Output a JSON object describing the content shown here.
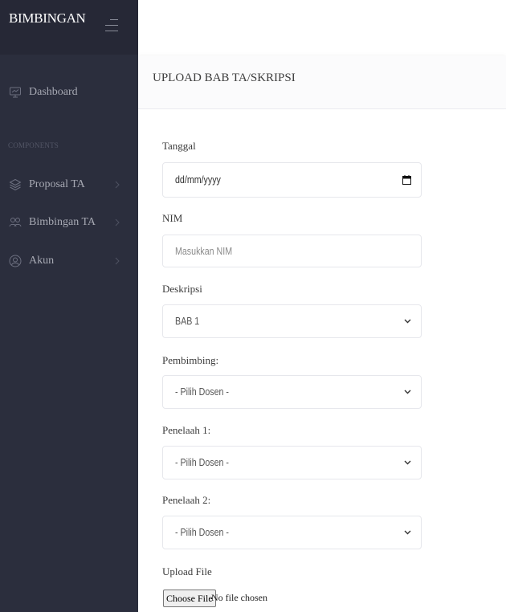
{
  "sidebar": {
    "brand": "BIMBINGAN",
    "section_label": "COMPONENTS",
    "items": [
      {
        "label": "Dashboard",
        "icon": "monitor-icon"
      },
      {
        "label": "Proposal TA",
        "icon": "layers-icon"
      },
      {
        "label": "Bimbingan TA",
        "icon": "users-icon"
      },
      {
        "label": "Akun",
        "icon": "user-circle-icon"
      }
    ]
  },
  "main": {
    "title": "UPLOAD BAB TA/SKRIPSI"
  },
  "form": {
    "tanggal": {
      "label": "Tanggal",
      "value": "dd/mm/yyyy"
    },
    "nim": {
      "label": "NIM",
      "placeholder": "Masukkan NIM"
    },
    "deskripsi": {
      "label": "Deskripsi",
      "selected": "BAB 1"
    },
    "pembimbing": {
      "label": "Pembimbing:",
      "selected": "- Pilih Dosen -"
    },
    "penelaah1": {
      "label": "Penelaah 1:",
      "selected": "- Pilih Dosen -"
    },
    "penelaah2": {
      "label": "Penelaah 2:",
      "selected": "- Pilih Dosen -"
    },
    "upload": {
      "label": "Upload File",
      "button": "Choose File",
      "status": "No file chosen"
    }
  },
  "colors": {
    "sidebar_bg": "#2b2e3d",
    "brand_bg": "#262836",
    "sidebar_text": "#a7a9b3"
  }
}
